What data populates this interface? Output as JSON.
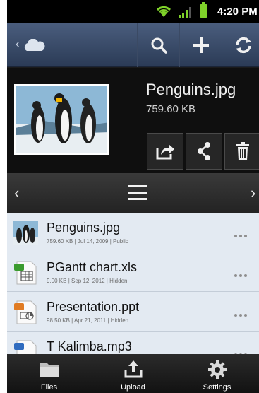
{
  "status_bar": {
    "time": "4:20 PM"
  },
  "action_bar": {
    "icons": [
      "back-chevron-icon",
      "cloud-icon",
      "search-icon",
      "add-icon",
      "refresh-icon"
    ]
  },
  "preview": {
    "file_name": "Penguins.jpg",
    "file_size": "759.60 KB",
    "actions": [
      "share-icon",
      "link-icon",
      "delete-icon"
    ]
  },
  "nav_strip": {
    "icons": [
      "prev-chevron-icon",
      "menu-icon",
      "next-chevron-icon"
    ]
  },
  "files": [
    {
      "name": "Penguins.jpg",
      "meta": "759.60 KB | Jul 14, 2009 | Public",
      "icon": "image-thumb-icon"
    },
    {
      "name": "PGantt chart.xls",
      "meta": "9.00 KB | Sep 12, 2012 | Hidden",
      "icon": "spreadsheet-icon"
    },
    {
      "name": "Presentation.ppt",
      "meta": "98.50 KB | Apr 21, 2011 | Hidden",
      "icon": "presentation-icon"
    },
    {
      "name": "T Kalimba.mp3",
      "meta": "",
      "icon": "audio-icon"
    }
  ],
  "tab_bar": {
    "tabs": [
      {
        "label": "Files",
        "icon": "folder-icon"
      },
      {
        "label": "Upload",
        "icon": "upload-icon"
      },
      {
        "label": "Settings",
        "icon": "gear-icon"
      }
    ]
  },
  "colors": {
    "action_bar": "#3a4b69",
    "list_bg": "#e3eaf2",
    "battery": "#7fd12a",
    "wifi": "#7fd12a"
  }
}
